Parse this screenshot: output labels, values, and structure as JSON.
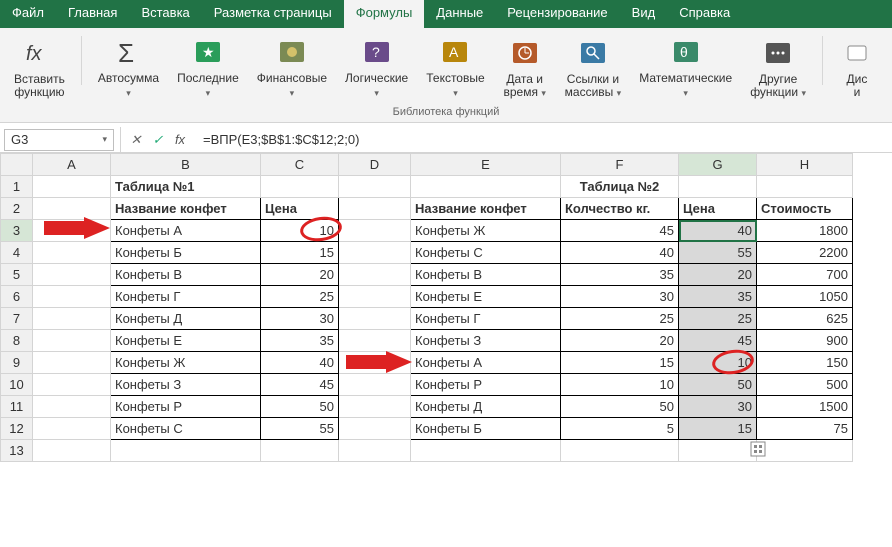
{
  "tabs": {
    "file": "Файл",
    "home": "Главная",
    "insert": "Вставка",
    "layout": "Разметка страницы",
    "formulas": "Формулы",
    "data": "Данные",
    "review": "Рецензирование",
    "view": "Вид",
    "help": "Справка"
  },
  "ribbon": {
    "insert_fn_line1": "Вставить",
    "insert_fn_line2": "функцию",
    "autosum": "Автосумма",
    "recent": "Последние",
    "financial": "Финансовые",
    "logical": "Логические",
    "text": "Текстовые",
    "datetime_line1": "Дата и",
    "datetime_line2": "время",
    "lookup_line1": "Ссылки и",
    "lookup_line2": "массивы",
    "math": "Математические",
    "more_line1": "Другие",
    "more_line2": "функции",
    "dis_line1": "Дис",
    "dis_line2": "и",
    "group_label": "Библиотека функций",
    "dropdown_glyph": "▾"
  },
  "formula_bar": {
    "cell_ref": "G3",
    "cancel": "✕",
    "confirm": "✓",
    "fx": "fx",
    "formula": "=ВПР(E3;$B$1:$C$12;2;0)"
  },
  "columns": [
    "A",
    "B",
    "C",
    "D",
    "E",
    "F",
    "G",
    "H"
  ],
  "headings": {
    "table1_title": "Таблица №1",
    "table2_title": "Таблица №2",
    "name": "Название конфет",
    "price": "Цена",
    "qty": "Колчество кг.",
    "cost": "Стоимость"
  },
  "chart_data": {
    "type": "table",
    "tables": [
      {
        "title": "Таблица №1",
        "columns": [
          "Название конфет",
          "Цена"
        ],
        "rows": [
          [
            "Конфеты А",
            10
          ],
          [
            "Конфеты Б",
            15
          ],
          [
            "Конфеты В",
            20
          ],
          [
            "Конфеты Г",
            25
          ],
          [
            "Конфеты Д",
            30
          ],
          [
            "Конфеты Е",
            35
          ],
          [
            "Конфеты Ж",
            40
          ],
          [
            "Конфеты З",
            45
          ],
          [
            "Конфеты Р",
            50
          ],
          [
            "Конфеты С",
            55
          ]
        ]
      },
      {
        "title": "Таблица №2",
        "columns": [
          "Название конфет",
          "Колчество кг.",
          "Цена",
          "Стоимость"
        ],
        "rows": [
          [
            "Конфеты Ж",
            45,
            40,
            1800
          ],
          [
            "Конфеты С",
            40,
            55,
            2200
          ],
          [
            "Конфеты В",
            35,
            20,
            700
          ],
          [
            "Конфеты Е",
            30,
            35,
            1050
          ],
          [
            "Конфеты Г",
            25,
            25,
            625
          ],
          [
            "Конфеты З",
            20,
            45,
            900
          ],
          [
            "Конфеты А",
            15,
            10,
            150
          ],
          [
            "Конфеты Р",
            10,
            50,
            500
          ],
          [
            "Конфеты Д",
            50,
            30,
            1500
          ],
          [
            "Конфеты Б",
            5,
            15,
            75
          ]
        ]
      }
    ]
  },
  "t1": {
    "r": [
      {
        "name": "Конфеты А",
        "price": "10"
      },
      {
        "name": "Конфеты Б",
        "price": "15"
      },
      {
        "name": "Конфеты В",
        "price": "20"
      },
      {
        "name": "Конфеты Г",
        "price": "25"
      },
      {
        "name": "Конфеты Д",
        "price": "30"
      },
      {
        "name": "Конфеты Е",
        "price": "35"
      },
      {
        "name": "Конфеты Ж",
        "price": "40"
      },
      {
        "name": "Конфеты З",
        "price": "45"
      },
      {
        "name": "Конфеты Р",
        "price": "50"
      },
      {
        "name": "Конфеты С",
        "price": "55"
      }
    ]
  },
  "t2": {
    "r": [
      {
        "name": "Конфеты Ж",
        "qty": "45",
        "price": "40",
        "cost": "1800"
      },
      {
        "name": "Конфеты С",
        "qty": "40",
        "price": "55",
        "cost": "2200"
      },
      {
        "name": "Конфеты В",
        "qty": "35",
        "price": "20",
        "cost": "700"
      },
      {
        "name": "Конфеты Е",
        "qty": "30",
        "price": "35",
        "cost": "1050"
      },
      {
        "name": "Конфеты Г",
        "qty": "25",
        "price": "25",
        "cost": "625"
      },
      {
        "name": "Конфеты З",
        "qty": "20",
        "price": "45",
        "cost": "900"
      },
      {
        "name": "Конфеты А",
        "qty": "15",
        "price": "10",
        "cost": "150"
      },
      {
        "name": "Конфеты Р",
        "qty": "10",
        "price": "50",
        "cost": "500"
      },
      {
        "name": "Конфеты Д",
        "qty": "50",
        "price": "30",
        "cost": "1500"
      },
      {
        "name": "Конфеты Б",
        "qty": "5",
        "price": "15",
        "cost": "75"
      }
    ]
  },
  "rows": [
    "1",
    "2",
    "3",
    "4",
    "5",
    "6",
    "7",
    "8",
    "9",
    "10",
    "11",
    "12",
    "13"
  ]
}
